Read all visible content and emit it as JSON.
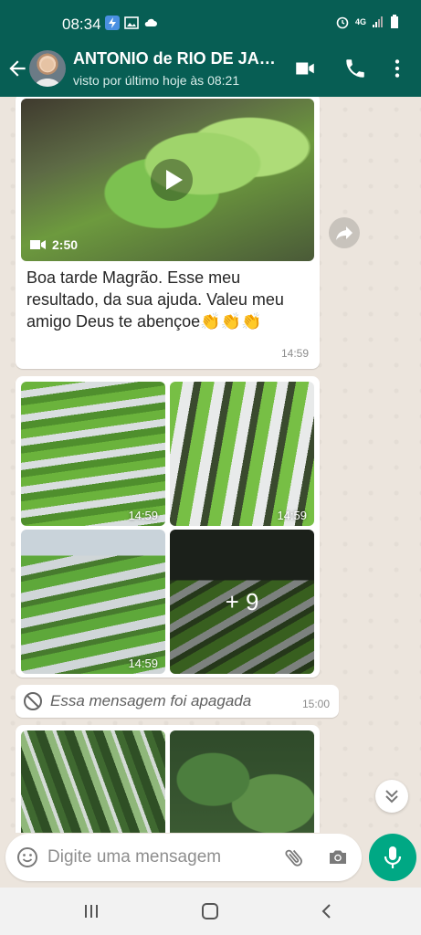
{
  "status_bar": {
    "time": "08:34",
    "network": "4G"
  },
  "header": {
    "contact_name": "ANTONIO de RIO DE JA…",
    "last_seen": "visto por último hoje às 08:21",
    "icons": [
      "back-arrow-icon",
      "video-call-icon",
      "phone-icon",
      "more-vert-icon"
    ]
  },
  "messages": {
    "video": {
      "duration": "2:50",
      "caption": "Boa tarde Magrão. Esse meu resultado, da sua ajuda. Valeu meu amigo Deus te abençoe",
      "emoji": "👏👏👏",
      "time": "14:59"
    },
    "album": {
      "images": [
        {
          "time": "14:59"
        },
        {
          "time": "14:59"
        },
        {
          "time": "14:59"
        },
        {
          "more_count": "+ 9"
        }
      ]
    },
    "deleted": {
      "text": "Essa mensagem foi apagada",
      "time": "15:00"
    }
  },
  "composer": {
    "placeholder": "Digite uma mensagem"
  },
  "colors": {
    "header": "#075e54",
    "accent": "#00a884",
    "chat_background": "#ece5dd"
  }
}
